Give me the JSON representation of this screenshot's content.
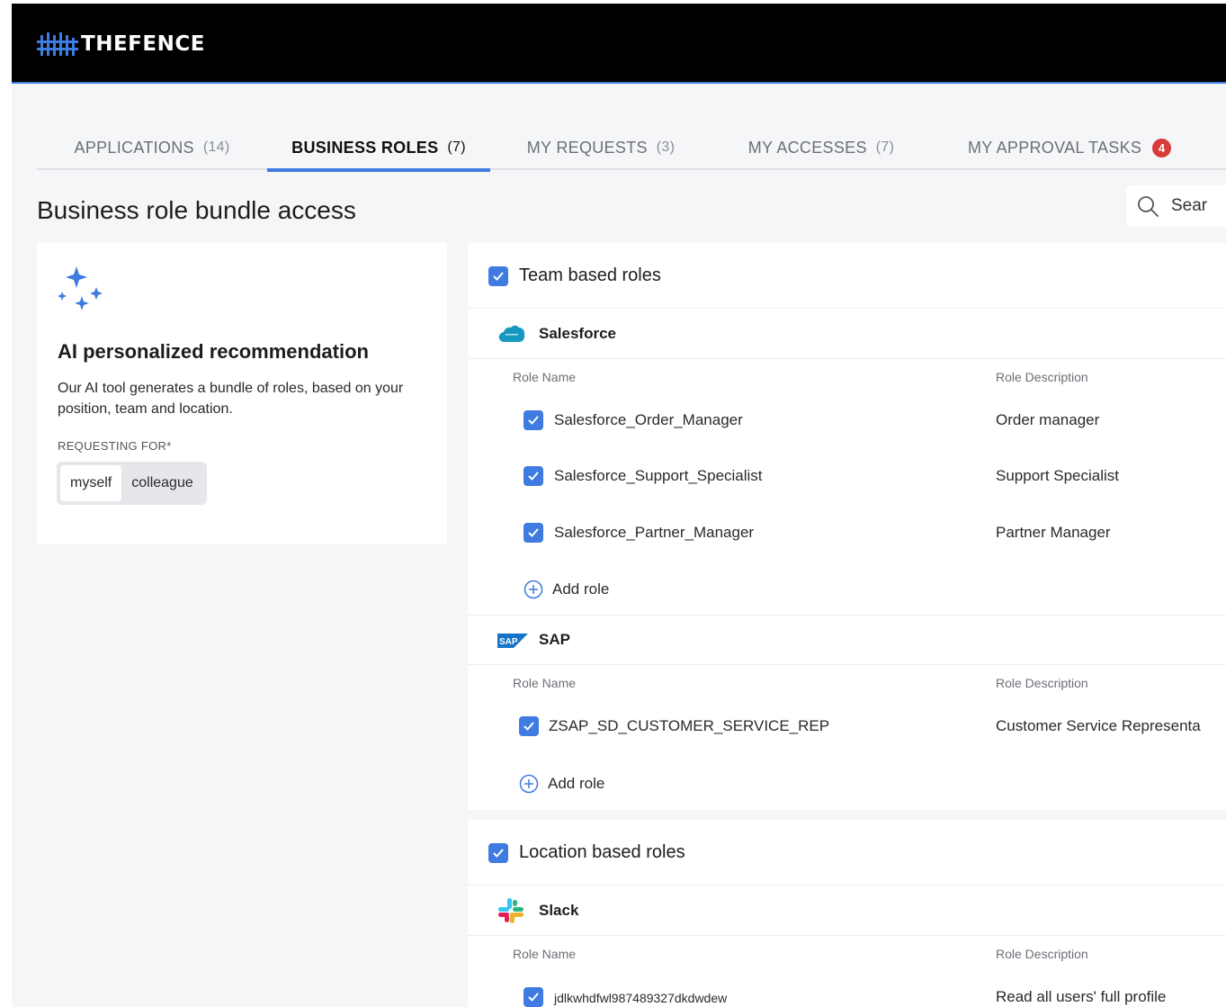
{
  "brand": {
    "name": "THEFENCE"
  },
  "tabs": [
    {
      "label": "APPLICATIONS",
      "count": "(14)"
    },
    {
      "label": "BUSINESS ROLES",
      "count": "(7)"
    },
    {
      "label": "MY REQUESTS",
      "count": "(3)"
    },
    {
      "label": "MY ACCESSES",
      "count": "(7)"
    },
    {
      "label": "MY APPROVAL TASKS",
      "badge": "4"
    }
  ],
  "active_tab": "BUSINESS ROLES",
  "page": {
    "title": "Business role bundle access"
  },
  "search": {
    "text": "Sear"
  },
  "ai_card": {
    "title": "AI personalized recommendation",
    "description": "Our AI tool generates a bundle of roles, based on your position, team and location.",
    "requesting_label": "REQUESTING FOR*",
    "options": [
      "myself",
      "colleague"
    ],
    "selected": "myself"
  },
  "team_section": {
    "title": "Team based roles",
    "checked": true,
    "apps": [
      {
        "name": "Salesforce",
        "icon": "salesforce-cloud-icon",
        "col_role_name": "Role Name",
        "col_role_desc": "Role Description",
        "roles": [
          {
            "name": "Salesforce_Order_Manager",
            "desc": "Order manager",
            "checked": true
          },
          {
            "name": "Salesforce_Support_Specialist",
            "desc": "Support Specialist",
            "checked": true
          },
          {
            "name": "Salesforce_Partner_Manager",
            "desc": "Partner Manager",
            "checked": true
          }
        ],
        "add_label": "Add role"
      },
      {
        "name": "SAP",
        "icon": "sap-logo-icon",
        "col_role_name": "Role Name",
        "col_role_desc": "Role Description",
        "roles": [
          {
            "name": "ZSAP_SD_CUSTOMER_SERVICE_REP",
            "desc": "Customer Service Representa",
            "checked": true
          }
        ],
        "add_label": "Add role"
      }
    ]
  },
  "location_section": {
    "title": "Location based roles",
    "checked": true,
    "apps": [
      {
        "name": "Slack",
        "icon": "slack-logo-icon",
        "col_role_name": "Role Name",
        "col_role_desc": "Role Description",
        "roles": [
          {
            "name": "jdlkwhdfwl987489327dkdwdew",
            "desc": "Read all users' full profile",
            "checked": true
          }
        ]
      }
    ]
  },
  "colors": {
    "accent": "#3f7be0",
    "topbar": "#000000",
    "badge": "#d93a3a",
    "page_bg": "#f5f6f8"
  }
}
